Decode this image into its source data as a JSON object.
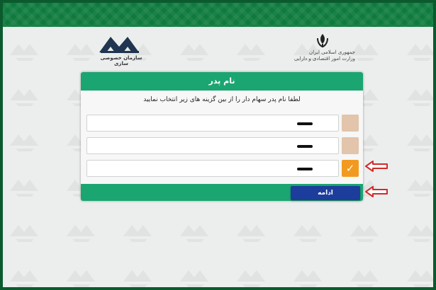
{
  "header": {
    "gov_logo_icon": "lion-and-sun-emblem-icon",
    "gov_logo_text_1": "جمهوری اسلامی ایران",
    "gov_logo_text_2": "وزارت امور اقتصادی و دارایی",
    "org_logo_icon": "privatization-organization-logo-icon",
    "org_logo_text": "سازمان خصوصی سازی"
  },
  "form": {
    "title": "نام پدر",
    "prompt": "لطفا نام پدر سهام دار را از بین گزینه های زیر انتخاب نمایید",
    "options": [
      {
        "label": "",
        "selected": false
      },
      {
        "label": "",
        "selected": false
      },
      {
        "label": "",
        "selected": true
      }
    ],
    "check_icon": "✓",
    "continue_label": "ادامه"
  },
  "annotations": {
    "arrow_icon": "red-outline-arrow-icon",
    "arrow_color": "#d22a2a"
  },
  "colors": {
    "header_green": "#1aa571",
    "top_band_green": "#0e7a3d",
    "button_blue": "#1c3d9b",
    "checkbox_unselected": "#e2c5ab",
    "checkbox_selected": "#f29a1f"
  }
}
